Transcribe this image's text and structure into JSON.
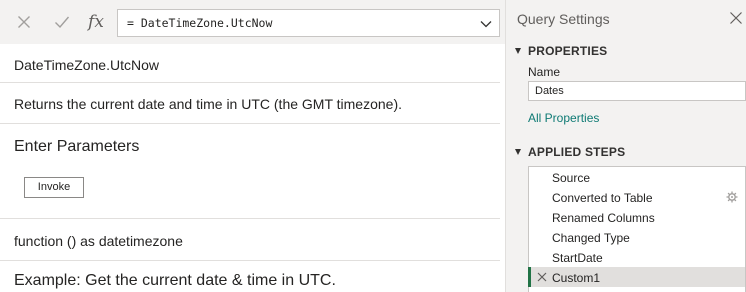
{
  "formula_bar": {
    "cancel_icon": "close-icon",
    "commit_icon": "check-icon",
    "fx_label": "fx",
    "formula": "= DateTimeZone.UtcNow"
  },
  "preview": {
    "function_name": "DateTimeZone.UtcNow",
    "description": "Returns the current date and time in UTC (the GMT timezone).",
    "parameters_heading": "Enter Parameters",
    "invoke_label": "Invoke",
    "signature": "function () as datetimezone",
    "example_heading": "Example: Get the current date & time in UTC."
  },
  "query_settings": {
    "title": "Query Settings",
    "properties_heading": "PROPERTIES",
    "name_label": "Name",
    "name_value": "Dates",
    "all_properties_link": "All Properties",
    "applied_steps_heading": "APPLIED STEPS",
    "steps": [
      {
        "label": "Source"
      },
      {
        "label": "Converted to Table",
        "has_gear": true
      },
      {
        "label": "Renamed Columns"
      },
      {
        "label": "Changed Type"
      },
      {
        "label": "StartDate"
      },
      {
        "label": "Custom1",
        "selected": true
      }
    ]
  },
  "colors": {
    "accent_green": "#217346",
    "link_teal": "#0e7a74",
    "pane_background": "#f3f2f1"
  }
}
